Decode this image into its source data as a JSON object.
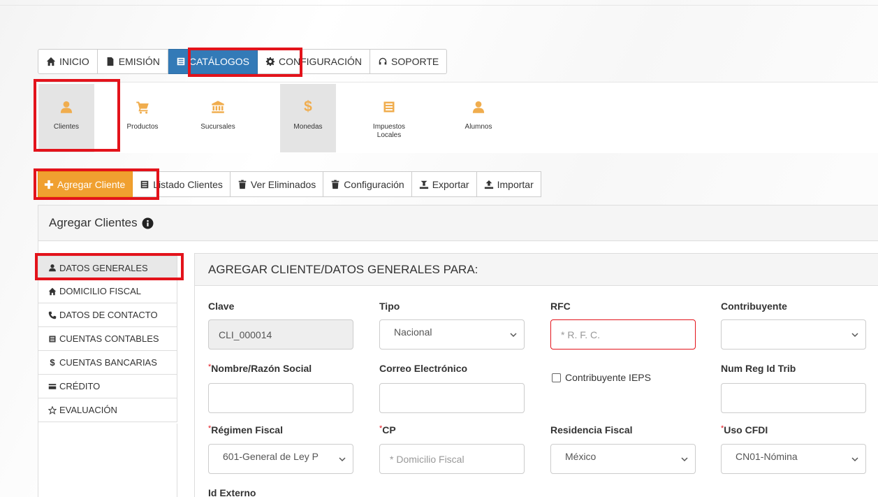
{
  "nav": {
    "tabs": [
      {
        "label": "INICIO",
        "icon": "home-icon"
      },
      {
        "label": "EMISIÓN",
        "icon": "file-icon"
      },
      {
        "label": "CATÁLOGOS",
        "icon": "list-icon",
        "active": true
      },
      {
        "label": "CONFIGURACIÓN",
        "icon": "gear-icon"
      },
      {
        "label": "SOPORTE",
        "icon": "headset-icon"
      }
    ]
  },
  "submenu": {
    "items": [
      {
        "label": "Clientes",
        "icon": "user-icon",
        "active": true
      },
      {
        "label": "Productos",
        "icon": "cart-icon"
      },
      {
        "label": "Sucursales",
        "icon": "bank-icon"
      },
      {
        "label": "Monedas",
        "icon": "dollar-icon"
      },
      {
        "label": "Impuestos Locales",
        "icon": "list-icon"
      },
      {
        "label": "Alumnos",
        "icon": "user-icon"
      }
    ]
  },
  "actions": {
    "add": "Agregar Cliente",
    "list": "Listado Clientes",
    "deleted": "Ver Eliminados",
    "config": "Configuración",
    "export": "Exportar",
    "import": "Importar"
  },
  "panel": {
    "title": "Agregar Clientes"
  },
  "sidemenu": {
    "items": [
      {
        "label": "DATOS GENERALES",
        "icon": "user-icon"
      },
      {
        "label": "DOMICILIO FISCAL",
        "icon": "home-icon"
      },
      {
        "label": "DATOS DE CONTACTO",
        "icon": "phone-icon"
      },
      {
        "label": "CUENTAS CONTABLES",
        "icon": "list-icon"
      },
      {
        "label": "CUENTAS BANCARIAS",
        "icon": "dollar-icon"
      },
      {
        "label": "CRÉDITO",
        "icon": "credit-card-icon"
      },
      {
        "label": "EVALUACIÓN",
        "icon": "star-icon"
      }
    ]
  },
  "form": {
    "title": "AGREGAR CLIENTE/DATOS GENERALES PARA:",
    "clave": {
      "label": "Clave",
      "value": "CLI_000014"
    },
    "tipo": {
      "label": "Tipo",
      "value": "Nacional"
    },
    "rfc": {
      "label": "RFC",
      "placeholder": "* R. F. C."
    },
    "contribuyente": {
      "label": "Contribuyente",
      "value": ""
    },
    "nombre": {
      "label": "Nombre/Razón Social",
      "value": ""
    },
    "correo": {
      "label": "Correo Electrónico",
      "value": ""
    },
    "ieps": {
      "label": "Contribuyente IEPS",
      "checked": false
    },
    "numreg": {
      "label": "Num Reg Id Trib",
      "value": ""
    },
    "regimen": {
      "label": "Régimen Fiscal",
      "value": "601-General de Ley P"
    },
    "cp": {
      "label": "CP",
      "placeholder": "* Domicilio Fiscal"
    },
    "residencia": {
      "label": "Residencia Fiscal",
      "value": "México"
    },
    "uso": {
      "label": "Uso CFDI",
      "value": "CN01-Nómina"
    },
    "idexterno": {
      "label": "Id Externo"
    }
  },
  "colors": {
    "primary": "#337ab7",
    "warning": "#f0a030",
    "highlight": "#e3131b"
  }
}
